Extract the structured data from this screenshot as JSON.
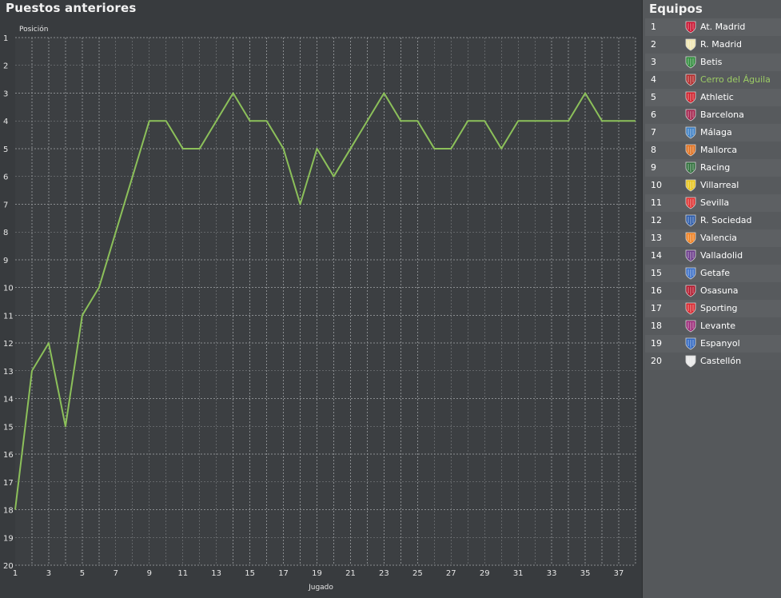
{
  "chart_panel": {
    "title": "Puestos anteriores",
    "ylabel": "Posición",
    "xlabel": "Jugado"
  },
  "teams_panel": {
    "title": "Equipos",
    "teams": [
      {
        "pos": "1",
        "name": "At. Madrid",
        "crest_icon": "atletico-crest-icon",
        "crest_color": "#c8102e"
      },
      {
        "pos": "2",
        "name": "R. Madrid",
        "crest_icon": "real-madrid-crest-icon",
        "crest_color": "#f0e6b0"
      },
      {
        "pos": "3",
        "name": "Betis",
        "crest_icon": "betis-crest-icon",
        "crest_color": "#2e8b3a"
      },
      {
        "pos": "4",
        "name": "Cerro del Águila",
        "crest_icon": "cerro-del-aguila-crest-icon",
        "crest_color": "#b02a2a",
        "highlight": true
      },
      {
        "pos": "5",
        "name": "Athletic",
        "crest_icon": "athletic-crest-icon",
        "crest_color": "#d01f2a"
      },
      {
        "pos": "6",
        "name": "Barcelona",
        "crest_icon": "barcelona-crest-icon",
        "crest_color": "#a2214b"
      },
      {
        "pos": "7",
        "name": "Málaga",
        "crest_icon": "malaga-crest-icon",
        "crest_color": "#3c7fc4"
      },
      {
        "pos": "8",
        "name": "Mallorca",
        "crest_icon": "mallorca-crest-icon",
        "crest_color": "#e0701e"
      },
      {
        "pos": "9",
        "name": "Racing",
        "crest_icon": "racing-crest-icon",
        "crest_color": "#2e6e3a"
      },
      {
        "pos": "10",
        "name": "Villarreal",
        "crest_icon": "villarreal-crest-icon",
        "crest_color": "#e8c51c"
      },
      {
        "pos": "11",
        "name": "Sevilla",
        "crest_icon": "sevilla-crest-icon",
        "crest_color": "#e03030"
      },
      {
        "pos": "12",
        "name": "R. Sociedad",
        "crest_icon": "real-sociedad-crest-icon",
        "crest_color": "#2b5aa8"
      },
      {
        "pos": "13",
        "name": "Valencia",
        "crest_icon": "valencia-crest-icon",
        "crest_color": "#f08020"
      },
      {
        "pos": "14",
        "name": "Valladolid",
        "crest_icon": "valladolid-crest-icon",
        "crest_color": "#6a3a8a"
      },
      {
        "pos": "15",
        "name": "Getafe",
        "crest_icon": "getafe-crest-icon",
        "crest_color": "#3a6fc8"
      },
      {
        "pos": "16",
        "name": "Osasuna",
        "crest_icon": "osasuna-crest-icon",
        "crest_color": "#b0162b"
      },
      {
        "pos": "17",
        "name": "Sporting",
        "crest_icon": "sporting-crest-icon",
        "crest_color": "#d8282f"
      },
      {
        "pos": "18",
        "name": "Levante",
        "crest_icon": "levante-crest-icon",
        "crest_color": "#9b2a78"
      },
      {
        "pos": "19",
        "name": "Espanyol",
        "crest_icon": "espanyol-crest-icon",
        "crest_color": "#2f66c0"
      },
      {
        "pos": "20",
        "name": "Castellón",
        "crest_icon": "castellon-crest-icon",
        "crest_color": "#e8e8e8"
      }
    ]
  },
  "colors": {
    "line": "#8cc05a",
    "highlight_text": "#9ccc65",
    "grid": "#8a8d90",
    "background": "#383b3e"
  },
  "chart_data": {
    "type": "line",
    "x": [
      1,
      2,
      3,
      4,
      5,
      6,
      7,
      8,
      9,
      10,
      11,
      12,
      13,
      14,
      15,
      16,
      17,
      18,
      19,
      20,
      21,
      22,
      23,
      24,
      25,
      26,
      27,
      28,
      29,
      30,
      31,
      32,
      33,
      34,
      35,
      36,
      37,
      38
    ],
    "series": [
      {
        "values": [
          18,
          13,
          12,
          15,
          11,
          10,
          8,
          6,
          4,
          4,
          5,
          5,
          4,
          3,
          4,
          4,
          5,
          7,
          5,
          6,
          5,
          4,
          3,
          4,
          4,
          5,
          5,
          4,
          4,
          5,
          4,
          4,
          4,
          4,
          3,
          4,
          4,
          4
        ]
      }
    ],
    "xticks": [
      1,
      3,
      5,
      7,
      9,
      11,
      13,
      15,
      17,
      19,
      21,
      23,
      25,
      27,
      29,
      31,
      33,
      35,
      37
    ],
    "yticks": [
      1,
      2,
      3,
      4,
      5,
      6,
      7,
      8,
      9,
      10,
      11,
      12,
      13,
      14,
      15,
      16,
      17,
      18,
      19,
      20
    ],
    "xlim": [
      1,
      38
    ],
    "ylim": [
      1,
      20
    ],
    "y_inverted": true,
    "xlabel": "Jugado",
    "ylabel": "Posición",
    "title": "Puestos anteriores",
    "grid": true
  }
}
